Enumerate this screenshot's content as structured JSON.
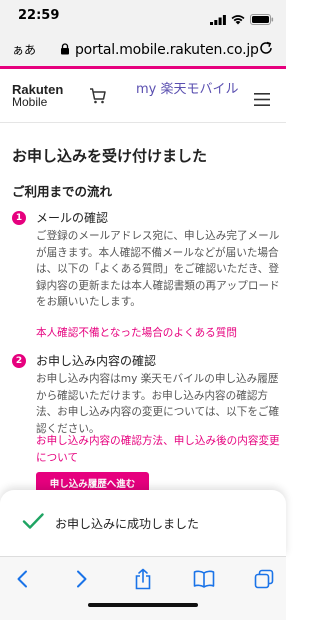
{
  "status_bar": {
    "time": "22:59"
  },
  "address_bar": {
    "text_size_label": "ぁあ",
    "url": "portal.mobile.rakuten.co.jp"
  },
  "header": {
    "logo_line1": "Rakuten",
    "logo_line2": "Mobile",
    "service_name": "my 楽天モバイル"
  },
  "main": {
    "title": "お申し込みを受け付けました",
    "section_title": "ご利用までの流れ",
    "steps": [
      {
        "number": "1",
        "title": "メールの確認",
        "body": "ご登録のメールアドレス宛に、申し込み完了メールが届きます。本人確認不備メールなどが届いた場合は、以下の「よくある質問」をご確認いただき、登録内容の更新または本人確認書類の再アップロードをお願いいたします。",
        "link": "本人確認不備となった場合のよくある質問"
      },
      {
        "number": "2",
        "title": "お申し込み内容の確認",
        "body": "お申し込み内容はmy 楽天モバイルの申し込み履歴から確認いただけます。お申し込み内容の確認方法、お申し込み内容の変更については、以下をご確認ください。",
        "link": "お申し込み内容の確認方法、申し込み後の内容変更について"
      }
    ],
    "history_button": "申し込み履歴へ進む"
  },
  "toast": {
    "message": "お申し込みに成功しました"
  },
  "colors": {
    "accent": "#e6007e",
    "service_purple": "#5a4fb0",
    "ios_blue": "#1a73e8",
    "success_green": "#1fa463"
  },
  "icons": {
    "status": [
      "signal-icon",
      "wifi-icon",
      "battery-icon"
    ],
    "address": [
      "lock-icon",
      "reload-icon"
    ],
    "header": [
      "cart-icon",
      "hamburger-menu-icon"
    ],
    "toast": "check-icon",
    "toolbar": [
      "back-icon",
      "forward-icon",
      "share-icon",
      "bookmarks-icon",
      "tabs-icon"
    ]
  }
}
